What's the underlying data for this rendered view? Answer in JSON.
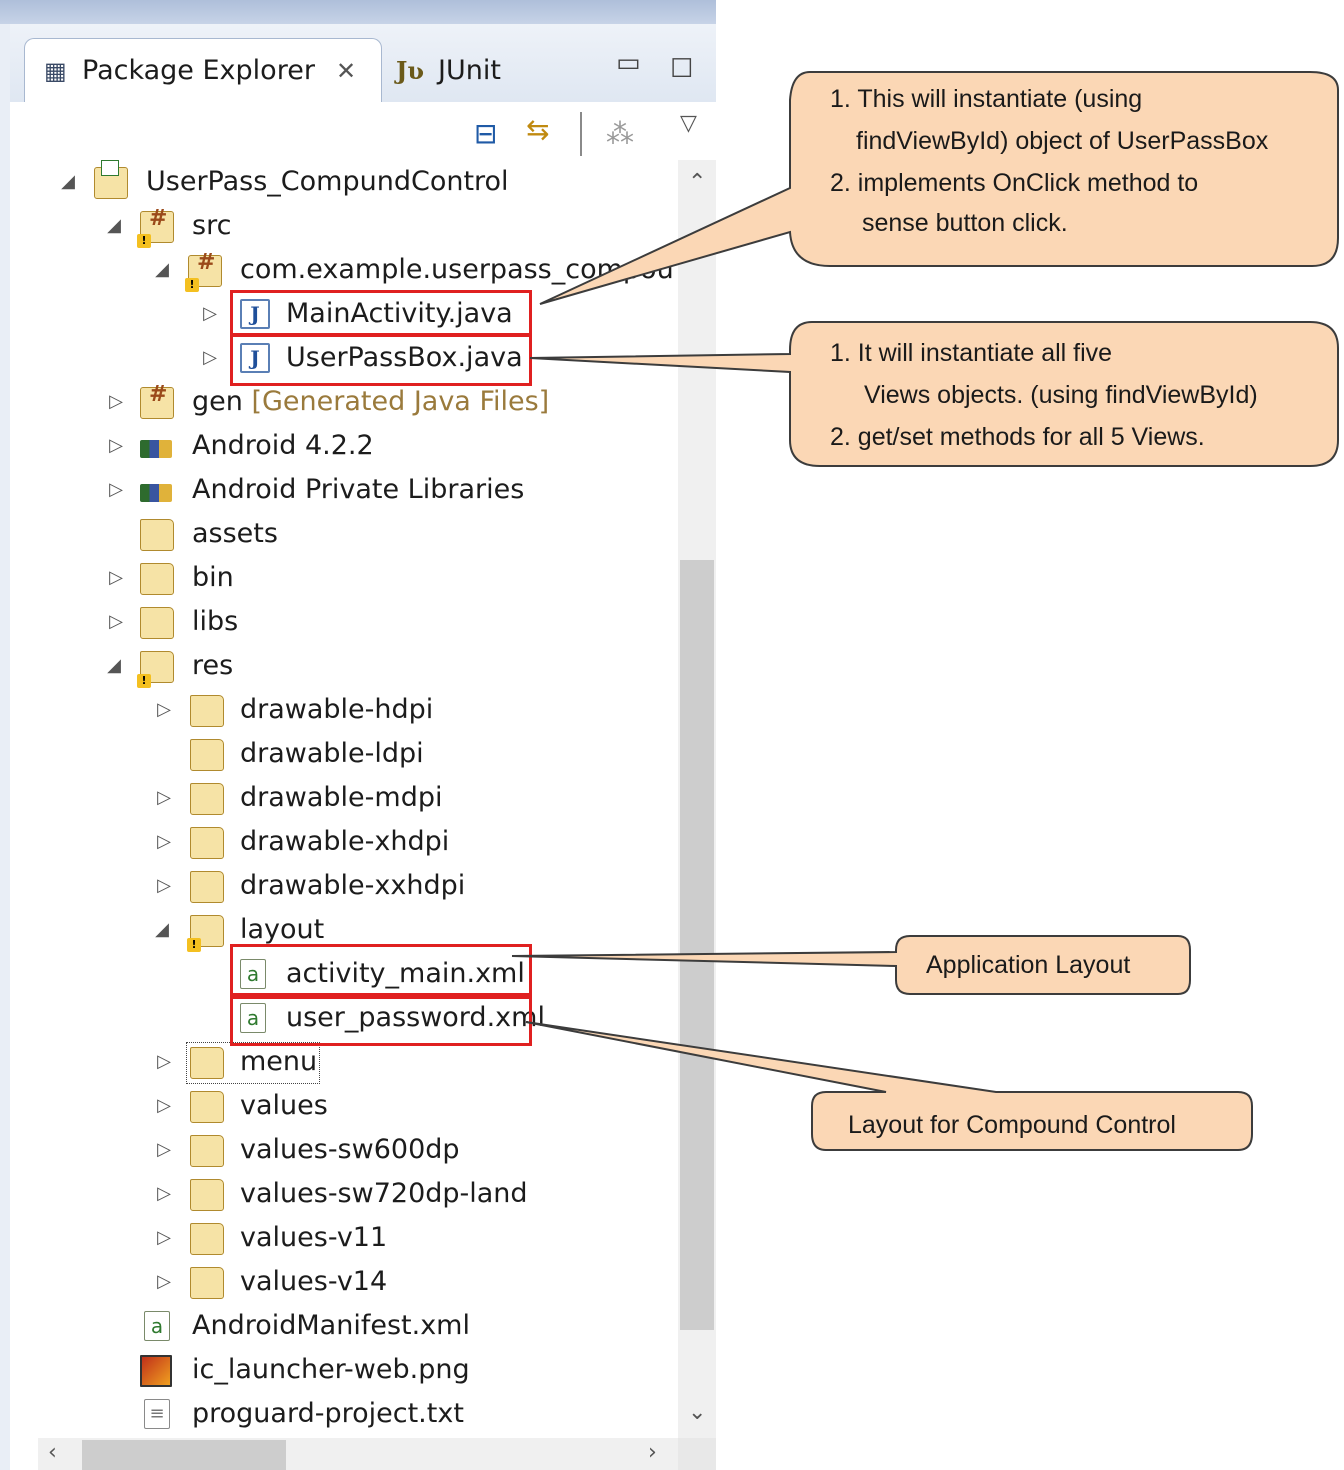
{
  "tabs": {
    "package_explorer": "Package Explorer",
    "junit": "JUnit"
  },
  "colors": {
    "callout_fill": "#fbd7b5",
    "callout_stroke": "#3c3c3c",
    "highlight": "#e02020",
    "panel_header": "#aebfda"
  },
  "tree": {
    "project": "UserPass_CompundControl",
    "src": "src",
    "package": "com.example.userpass_compound",
    "main_activity": "MainActivity.java",
    "userpassbox": "UserPassBox.java",
    "gen": "gen",
    "gen_decoration": "[Generated Java Files]",
    "android_lib": "Android 4.2.2",
    "private_libs": "Android Private Libraries",
    "assets": "assets",
    "bin": "bin",
    "libs": "libs",
    "res": "res",
    "drawable_hdpi": "drawable-hdpi",
    "drawable_ldpi": "drawable-ldpi",
    "drawable_mdpi": "drawable-mdpi",
    "drawable_xhdpi": "drawable-xhdpi",
    "drawable_xxhdpi": "drawable-xxhdpi",
    "layout": "layout",
    "activity_main": "activity_main.xml",
    "user_password": "user_password.xml",
    "menu": "menu",
    "values": "values",
    "values_sw600dp": "values-sw600dp",
    "values_sw720dp_land": "values-sw720dp-land",
    "values_v11": "values-v11",
    "values_v14": "values-v14",
    "manifest": "AndroidManifest.xml",
    "ic_launcher": "ic_launcher-web.png",
    "proguard": "proguard-project.txt"
  },
  "callouts": {
    "main_activity": {
      "line1": "1. This will instantiate (using",
      "line2": "findViewById) object of UserPassBox",
      "line3": "2. implements OnClick method to",
      "line4": "sense button click."
    },
    "userpassbox": {
      "line1": "1. It will instantiate all five",
      "line2": "Views objects. (using findViewById)",
      "line3": "2.  get/set methods for all 5 Views."
    },
    "app_layout": "Application Layout",
    "compound_layout": "Layout for Compound Control"
  }
}
